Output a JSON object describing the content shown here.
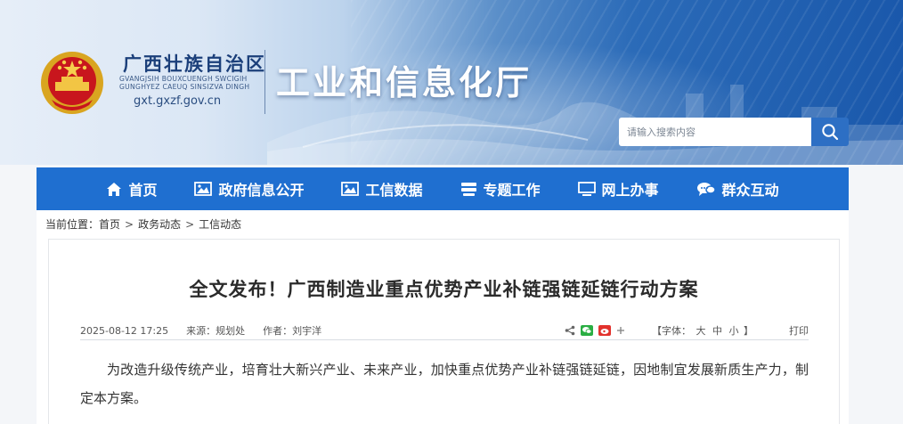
{
  "header": {
    "region_name": "广西壮族自治区",
    "region_name_zhuang_line1": "GVANGJSIH BOUXCUENGH SWCIGIH",
    "region_name_zhuang_line2": "GUNGHYEZ CAEUQ SINSIZVA DINGH",
    "url": "gxt.gxzf.gov.cn",
    "department": "工业和信息化厅",
    "emblem_icon": "national-emblem-icon"
  },
  "search": {
    "placeholder": "请输入搜索内容",
    "value": "",
    "icon": "search-icon"
  },
  "nav": {
    "items": [
      {
        "label": "首页",
        "icon": "home-icon"
      },
      {
        "label": "政府信息公开",
        "icon": "image-icon"
      },
      {
        "label": "工信数据",
        "icon": "image-icon"
      },
      {
        "label": "专题工作",
        "icon": "stack-icon"
      },
      {
        "label": "网上办事",
        "icon": "monitor-icon"
      },
      {
        "label": "群众互动",
        "icon": "chat-icon"
      }
    ]
  },
  "breadcrumb": {
    "prefix": "当前位置：",
    "items": [
      "首页",
      "政务动态",
      "工信动态"
    ],
    "separator": ">"
  },
  "article": {
    "title": "全文发布！广西制造业重点优势产业补链强链延链行动方案",
    "date": "2025-08-12 17:25",
    "source_label": "来源：",
    "source": "规划处",
    "author_label": "作者：",
    "author": "刘宇洋",
    "font_size_label": "【字体：",
    "font_sizes": [
      "大",
      "中",
      "小"
    ],
    "font_size_close": "】",
    "print_label": "打印",
    "body": "为改造升级传统产业，培育壮大新兴产业、未来产业，加快重点优势产业补链强链延链，因地制宜发展新质生产力，制定本方案。"
  },
  "colors": {
    "nav_bg": "#1f6fd0",
    "search_btn": "#2d6fc4",
    "dept_text": "#ffffff"
  }
}
